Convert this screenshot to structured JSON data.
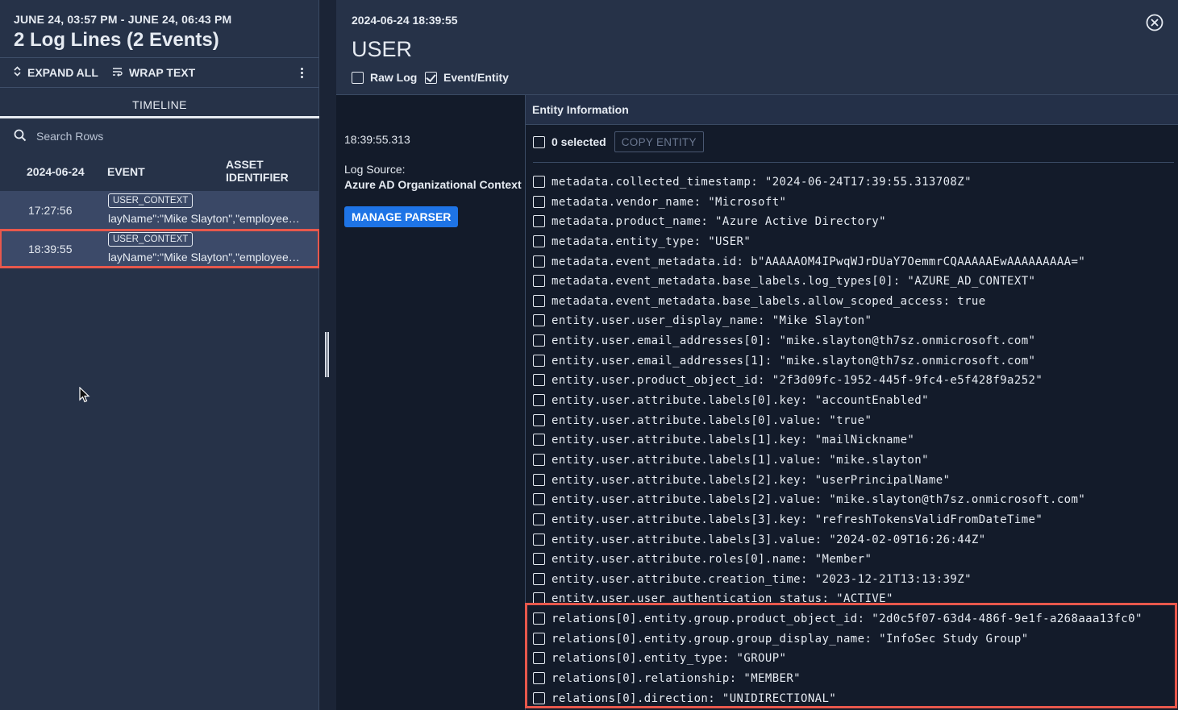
{
  "left_panel": {
    "date_range": "JUNE 24, 03:57 PM - JUNE 24, 06:43 PM",
    "title": "2 Log Lines (2 Events)",
    "toolbar": {
      "expand_all": "EXPAND ALL",
      "wrap_text": "WRAP TEXT"
    },
    "tab": "TIMELINE",
    "search_placeholder": "Search Rows",
    "columns": {
      "date": "2024-06-24",
      "event": "EVENT",
      "asset_line1": "ASSET",
      "asset_line2": "IDENTIFIER"
    },
    "rows": [
      {
        "time": "17:27:56",
        "badge": "USER_CONTEXT",
        "snippet": "layName\":\"Mike Slayton\",\"employeeId\"",
        "selected": false
      },
      {
        "time": "18:39:55",
        "badge": "USER_CONTEXT",
        "snippet": "layName\":\"Mike Slayton\",\"employeeId\"",
        "selected": true
      }
    ]
  },
  "detail": {
    "timestamp": "2024-06-24 18:39:55",
    "entity_type": "USER",
    "raw_log_label": "Raw Log",
    "raw_log_checked": false,
    "event_entity_label": "Event/Entity",
    "event_entity_checked": true,
    "meta": {
      "time": "18:39:55.313",
      "log_source_label": "Log Source:",
      "log_source": "Azure AD Organizational Context",
      "manage_parser": "MANAGE PARSER"
    },
    "entity_header": "Entity Information",
    "selected_count": "0 selected",
    "copy_entity": "COPY ENTITY",
    "fields": [
      "metadata.collected_timestamp: \"2024-06-24T17:39:55.313708Z\"",
      "metadata.vendor_name: \"Microsoft\"",
      "metadata.product_name: \"Azure Active Directory\"",
      "metadata.entity_type: \"USER\"",
      "metadata.event_metadata.id: b\"AAAAAOM4IPwqWJrDUaY7OemmrCQAAAAAEwAAAAAAAAA=\"",
      "metadata.event_metadata.base_labels.log_types[0]: \"AZURE_AD_CONTEXT\"",
      "metadata.event_metadata.base_labels.allow_scoped_access: true",
      "entity.user.user_display_name: \"Mike Slayton\"",
      "entity.user.email_addresses[0]: \"mike.slayton@th7sz.onmicrosoft.com\"",
      "entity.user.email_addresses[1]: \"mike.slayton@th7sz.onmicrosoft.com\"",
      "entity.user.product_object_id: \"2f3d09fc-1952-445f-9fc4-e5f428f9a252\"",
      "entity.user.attribute.labels[0].key: \"accountEnabled\"",
      "entity.user.attribute.labels[0].value: \"true\"",
      "entity.user.attribute.labels[1].key: \"mailNickname\"",
      "entity.user.attribute.labels[1].value: \"mike.slayton\"",
      "entity.user.attribute.labels[2].key: \"userPrincipalName\"",
      "entity.user.attribute.labels[2].value: \"mike.slayton@th7sz.onmicrosoft.com\"",
      "entity.user.attribute.labels[3].key: \"refreshTokensValidFromDateTime\"",
      "entity.user.attribute.labels[3].value: \"2024-02-09T16:26:44Z\"",
      "entity.user.attribute.roles[0].name: \"Member\"",
      "entity.user.attribute.creation_time: \"2023-12-21T13:13:39Z\"",
      "entity.user.user_authentication_status: \"ACTIVE\"",
      "relations[0].entity.group.product_object_id: \"2d0c5f07-63d4-486f-9e1f-a268aaa13fc0\"",
      "relations[0].entity.group.group_display_name: \"InfoSec Study Group\"",
      "relations[0].entity_type: \"GROUP\"",
      "relations[0].relationship: \"MEMBER\"",
      "relations[0].direction: \"UNIDIRECTIONAL\""
    ]
  },
  "colors": {
    "highlight": "#e8584c",
    "accent_button": "#1e74e6",
    "left_panel_bg": "#263248",
    "detail_bg": "#131b2a"
  }
}
